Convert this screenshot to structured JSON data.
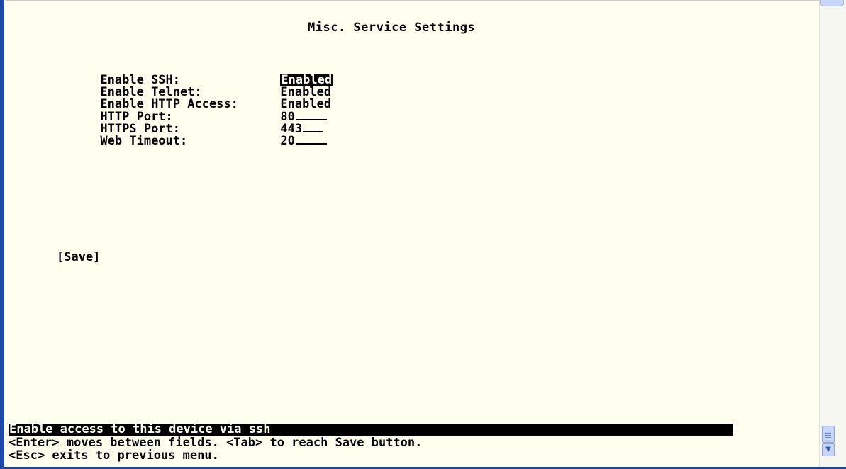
{
  "screen": {
    "title": "Misc. Service Settings"
  },
  "fields": [
    {
      "label": "Enable SSH:",
      "value": "Enabled",
      "selected": true
    },
    {
      "label": "Enable Telnet:",
      "value": "Enabled",
      "selected": false
    },
    {
      "label": "Enable HTTP Access:",
      "value": "Enabled",
      "selected": false
    },
    {
      "label": "HTTP Port:",
      "value": "80",
      "selected": false
    },
    {
      "label": "HTTPS Port:",
      "value": "443",
      "selected": false
    },
    {
      "label": "Web Timeout:",
      "value": "20",
      "selected": false
    }
  ],
  "actions": {
    "save_label": "[Save]"
  },
  "status": {
    "message": "Enable access to this device via ssh",
    "help_line_1": "<Enter> moves between fields. <Tab> to reach Save button.",
    "help_line_2": "<Esc> exits to previous menu."
  },
  "icons": {
    "scroll_down": "chevron-down-icon",
    "scroll_thumb": "grip-icon"
  },
  "colors": {
    "terminal_background": "#fffff0",
    "text": "#000000",
    "highlight_background": "#000000",
    "window_border": "#1f49a6"
  }
}
